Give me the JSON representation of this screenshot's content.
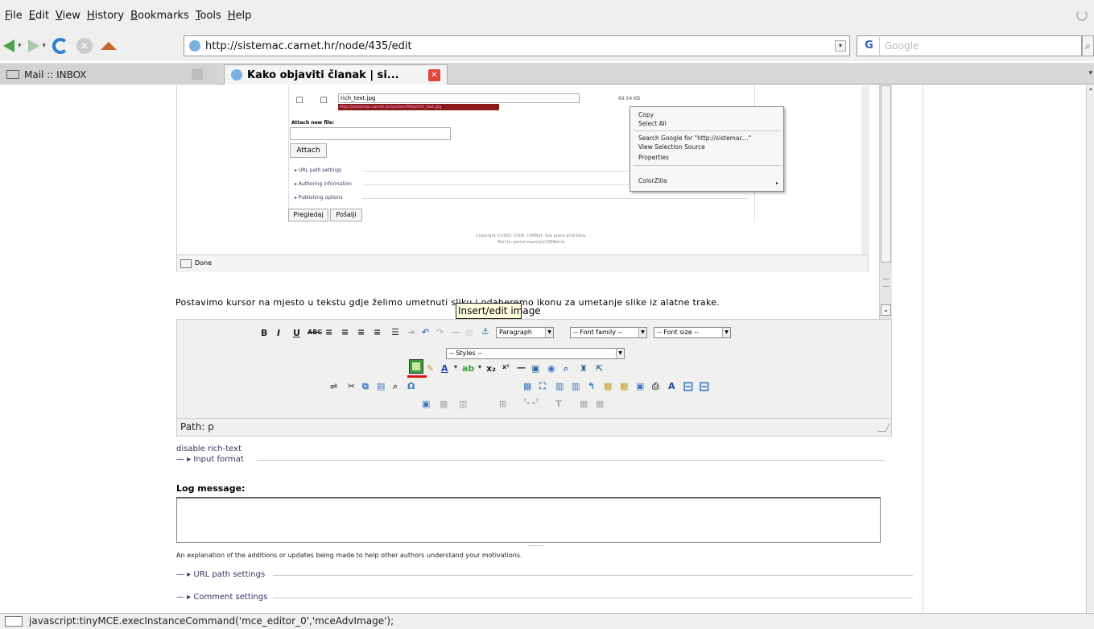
{
  "menubar": {
    "items": [
      "File",
      "Edit",
      "View",
      "History",
      "Bookmarks",
      "Tools",
      "Help"
    ]
  },
  "navbar": {
    "url": "http://sistemac.carnet.hr/node/435/edit",
    "search_placeholder": "Google"
  },
  "tabs": [
    {
      "label": "Mail :: INBOX",
      "active": false
    },
    {
      "label": "Kako objaviti članak | si...",
      "active": true
    }
  ],
  "embedded": {
    "file_name": "rich_text.jpg",
    "file_size": "69.54 KB",
    "file_url": "http://sistemac.carnet.hr/system/files/rich_text.jpg",
    "attach_label": "Attach new file:",
    "attach_button": "Attach",
    "links": [
      "URL path settings",
      "Authoring information",
      "Publishing options"
    ],
    "preview_button": "Pregledaj",
    "send_button": "Pošalji",
    "copyright_line1": "Copyright ©2000.-2006. CARNet. Sva prava pridržana.",
    "copyright_line2": "Mail to: portal-team(at)CARNet.hr",
    "status": "Done"
  },
  "context_menu": {
    "items": [
      "Copy",
      "Select All",
      "Search Google for \"http://sistemac...\"",
      "View Selection Source",
      "Properties",
      "ColorZilla"
    ]
  },
  "paragraph": "Postavimo kursor na mjesto u tekstu gdje želimo umetnuti sliku i odaberemo ikonu za umetanje slike iz alatne trake.",
  "editor": {
    "format_select": "Paragraph",
    "font_family_select": "-- Font family --",
    "font_size_select": "-- Font size --",
    "styles_select": "-- Styles --",
    "tooltip": "Insert/edit image",
    "path": "Path: p"
  },
  "form": {
    "disable_rich_text": "disable rich-text",
    "input_format": "Input format",
    "log_message_label": "Log message:",
    "log_explanation": "An explanation of the additions or updates being made to help other authors understand your motivations.",
    "url_path_settings": "URL path settings",
    "comment_settings": "Comment settings"
  },
  "statusbar": {
    "text": "javascript:tinyMCE.execInstanceCommand('mce_editor_0','mceAdvImage');"
  }
}
